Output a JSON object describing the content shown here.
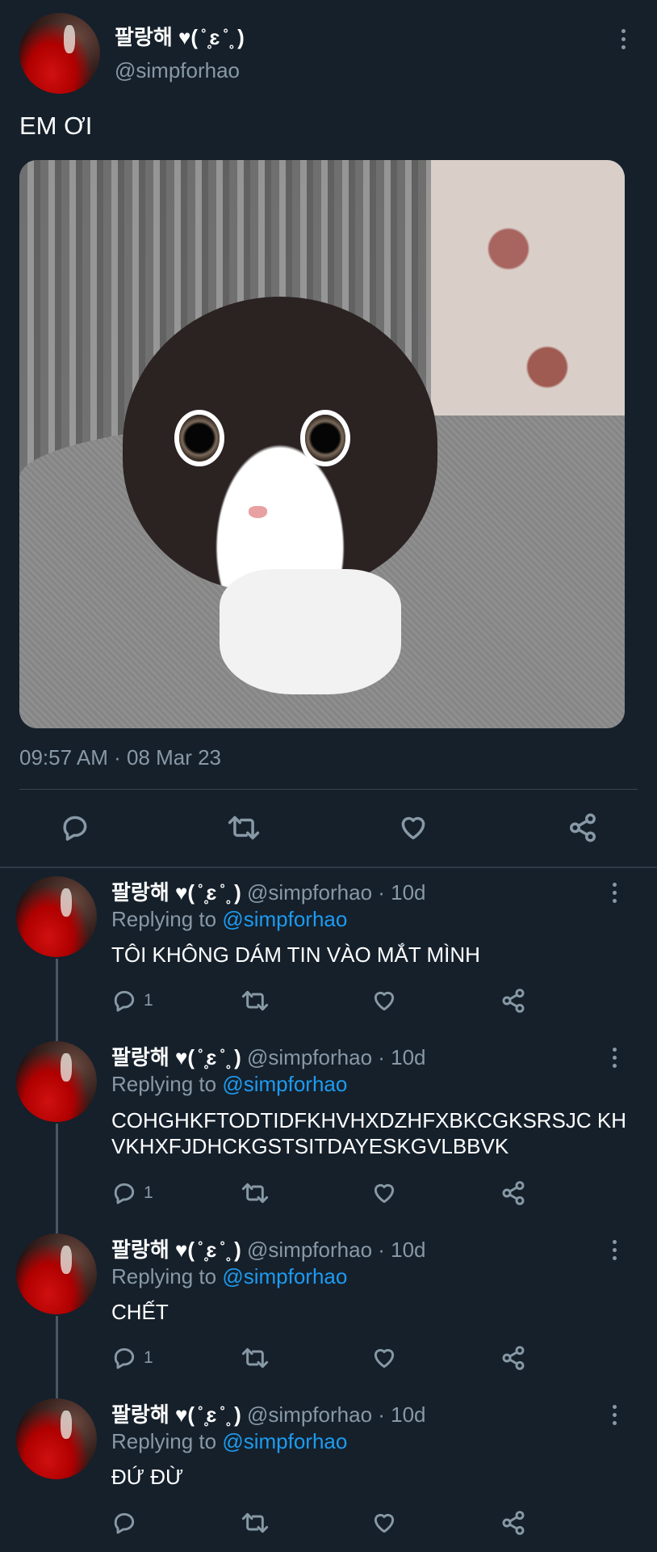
{
  "main_tweet": {
    "display_name": "팔랑해 ♥( ̊ ̥ɛ ̊ ̥ )",
    "handle": "@simpforhao",
    "text": "EM ƠI",
    "timestamp": "09:57 AM · 08 Mar 23"
  },
  "replies": [
    {
      "display_name": "팔랑해 ♥( ̊ ̥ɛ ̊ ̥ )",
      "meta": "@simpforhao · 10d",
      "replying_prefix": "Replying to",
      "replying_handle": "@simpforhao",
      "text": "TÔI KHÔNG DÁM TIN VÀO MẮT MÌNH",
      "reply_count": "1"
    },
    {
      "display_name": "팔랑해 ♥( ̊ ̥ɛ ̊ ̥ )",
      "meta": "@simpforhao · 10d",
      "replying_prefix": "Replying to",
      "replying_handle": "@simpforhao",
      "text": "COHGHKFTODTIDFKHVHXDZHFXBKCGKSRSJC KHVKHXFJDHCKGSTSITDAYESKGVLBBVK",
      "reply_count": "1"
    },
    {
      "display_name": "팔랑해 ♥( ̊ ̥ɛ ̊ ̥ )",
      "meta": "@simpforhao · 10d",
      "replying_prefix": "Replying to",
      "replying_handle": "@simpforhao",
      "text": "CHẾT",
      "reply_count": "1"
    },
    {
      "display_name": "팔랑해 ♥( ̊ ̥ɛ ̊ ̥ )",
      "meta": "@simpforhao · 10d",
      "replying_prefix": "Replying to",
      "replying_handle": "@simpforhao",
      "text": "ĐỨ ĐỪ",
      "reply_count": ""
    }
  ],
  "icons": {
    "reply": "reply-icon",
    "retweet": "retweet-icon",
    "like": "like-icon",
    "share": "share-icon",
    "more": "more-vertical-icon"
  },
  "colors": {
    "background": "#15202b",
    "muted": "#8899a6",
    "link": "#1d9bf0",
    "divider": "#38444d"
  }
}
